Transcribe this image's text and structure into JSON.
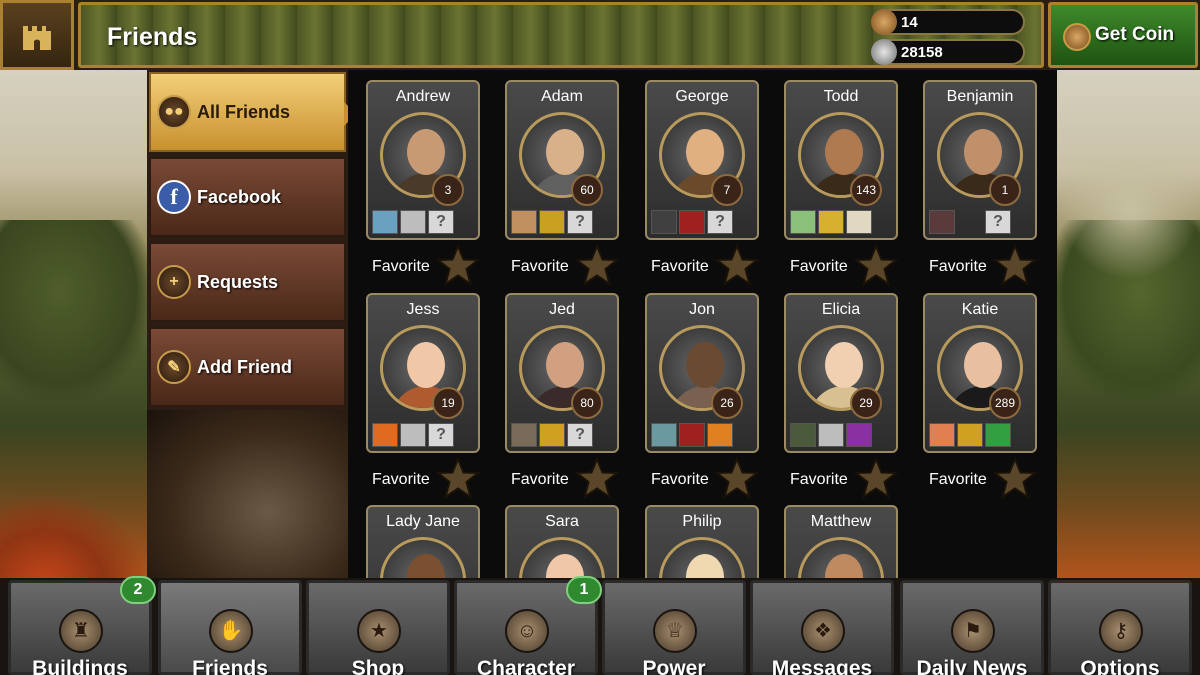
{
  "header": {
    "title": "Friends"
  },
  "resources": {
    "coins": "14",
    "silver": "28158"
  },
  "get_coin": {
    "label": "Get Coin"
  },
  "sidebar": {
    "items": [
      {
        "label": "All Friends",
        "icon": "friends-icon",
        "active": true
      },
      {
        "label": "Facebook",
        "icon": "facebook-icon"
      },
      {
        "label": "Requests",
        "icon": "add-request-icon"
      },
      {
        "label": "Add Friend",
        "icon": "scroll-icon"
      }
    ]
  },
  "friends": {
    "favorite_label": "Favorite",
    "unknown_symbol": "?",
    "cards": [
      {
        "name": "Andrew",
        "level": "3",
        "skin": "#c89a74",
        "cloth": "#4a3a2a",
        "squares": [
          "#6aa0c0",
          "#bdbdbd",
          "?"
        ]
      },
      {
        "name": "Adam",
        "level": "60",
        "skin": "#d8b08a",
        "cloth": "#606060",
        "squares": [
          "#c09060",
          "#c9a020",
          "?"
        ]
      },
      {
        "name": "George",
        "level": "7",
        "skin": "#e0b080",
        "cloth": "#6a4a2a",
        "squares": [
          "#404040",
          "#a02020",
          "?"
        ]
      },
      {
        "name": "Todd",
        "level": "143",
        "skin": "#b07a50",
        "cloth": "#3a2a1a",
        "squares": [
          "#8ac07a",
          "#d8b030",
          "#e0d8c0"
        ]
      },
      {
        "name": "Benjamin",
        "level": "1",
        "skin": "#c0906a",
        "cloth": "#3a2a1a",
        "squares": [
          "#5a3a3a",
          "",
          "?"
        ]
      },
      {
        "name": "Jess",
        "level": "19",
        "skin": "#f0c8a8",
        "cloth": "#b05a30",
        "squares": [
          "#e06a20",
          "#bdbdbd",
          "?"
        ]
      },
      {
        "name": "Jed",
        "level": "80",
        "skin": "#d0a080",
        "cloth": "#3a2a2a",
        "squares": [
          "#7a6a5a",
          "#d0a020",
          "?"
        ]
      },
      {
        "name": "Jon",
        "level": "26",
        "skin": "#6a4a30",
        "cloth": "#7a6050",
        "squares": [
          "#6a9aa0",
          "#a02020",
          "#e08020"
        ]
      },
      {
        "name": "Elicia",
        "level": "29",
        "skin": "#f0d0b0",
        "cloth": "#d8c090",
        "squares": [
          "#4a5a3a",
          "#bdbdbd",
          "#8a30a0"
        ]
      },
      {
        "name": "Katie",
        "level": "289",
        "skin": "#e8c0a0",
        "cloth": "#1a1a1a",
        "squares": [
          "#e08050",
          "#d0a020",
          "#30a040"
        ]
      },
      {
        "name": "Lady Jane",
        "skin": "#7a5030",
        "cloth": "#5a3a20"
      },
      {
        "name": "Sara",
        "skin": "#f0c8a8",
        "cloth": "#a05020"
      },
      {
        "name": "Philip",
        "skin": "#f0d8b0",
        "cloth": "#d8c8a0"
      },
      {
        "name": "Matthew",
        "skin": "#c08a60",
        "cloth": "#3a2a1a"
      }
    ]
  },
  "bottom_nav": {
    "tabs": [
      {
        "label": "Buildings",
        "icon": "tower-icon",
        "badge": "2"
      },
      {
        "label": "Friends",
        "icon": "handshake-icon"
      },
      {
        "label": "Shop",
        "icon": "coin-bag-icon"
      },
      {
        "label": "Character",
        "icon": "character-portrait-icon",
        "badge": "1"
      },
      {
        "label": "Power",
        "icon": "iron-throne-icon"
      },
      {
        "label": "Messages",
        "icon": "raven-icon"
      },
      {
        "label": "Daily News",
        "icon": "banner-icon"
      },
      {
        "label": "Options",
        "icon": "keys-icon"
      }
    ]
  }
}
